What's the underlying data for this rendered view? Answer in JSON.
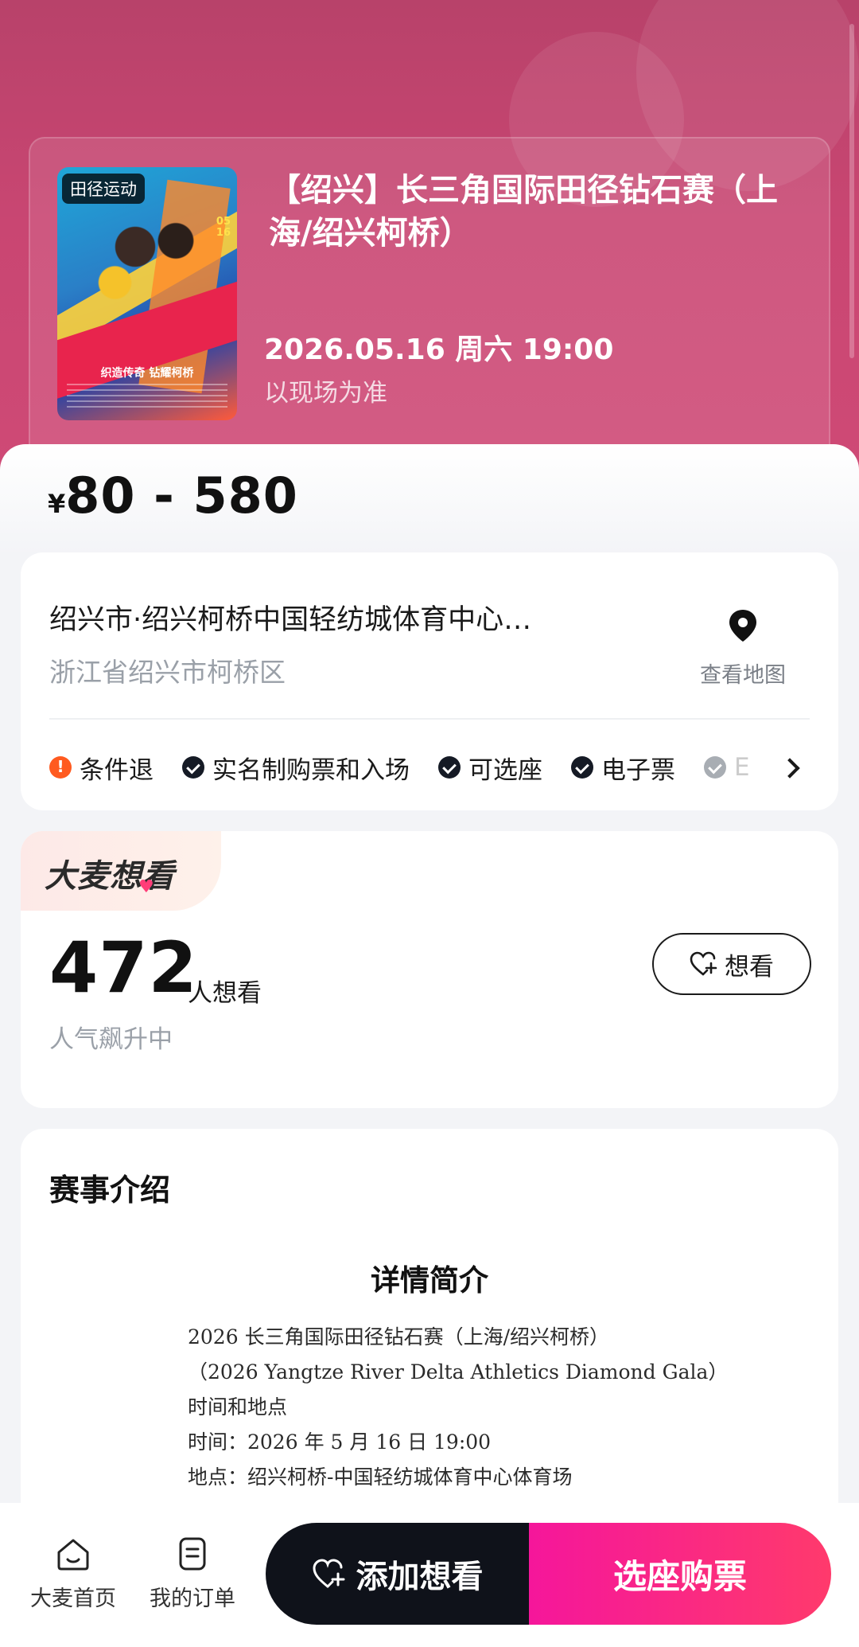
{
  "event": {
    "poster_tag": "田径运动",
    "poster_date": "05\n16",
    "poster_slogan": "织造传奇 钻耀柯桥",
    "title": "【绍兴】长三角国际田径钻石赛（上海/绍兴柯桥）",
    "datetime": "2026.05.16 周六 19:00",
    "note": "以现场为准"
  },
  "price": {
    "currency": "¥",
    "range": "80 - 580"
  },
  "venue": {
    "name": "绍兴市·绍兴柯桥中国轻纺城体育中心…",
    "address": "浙江省绍兴市柯桥区",
    "map_label": "查看地图",
    "tags": [
      {
        "label": "条件退",
        "type": "warn"
      },
      {
        "label": "实名制购票和入场",
        "type": "ok"
      },
      {
        "label": "可选座",
        "type": "ok"
      },
      {
        "label": "电子票",
        "type": "ok"
      },
      {
        "label": "E",
        "type": "grey"
      }
    ]
  },
  "want": {
    "badge": "大麦想看",
    "count": "472",
    "unit": "人想看",
    "sub": "人气飙升中",
    "button": "想看"
  },
  "intro": {
    "title": "赛事介绍",
    "subtitle": "详情简介",
    "lines": [
      "2026 长三角国际田径钻石赛（上海/绍兴柯桥）",
      "（2026 Yangtze River Delta Athletics Diamond Gala）",
      "时间和地点",
      "时间：2026 年 5 月 16 日 19:00",
      "地点：绍兴柯桥-中国轻纺城体育中心体育场"
    ]
  },
  "bottom_nav": {
    "home": "大麦首页",
    "orders": "我的订单",
    "add_want": "添加想看",
    "buy": "选座购票"
  },
  "colors": {
    "hero": "#c94672",
    "accent": "#f5169b",
    "dark": "#0f121a"
  }
}
